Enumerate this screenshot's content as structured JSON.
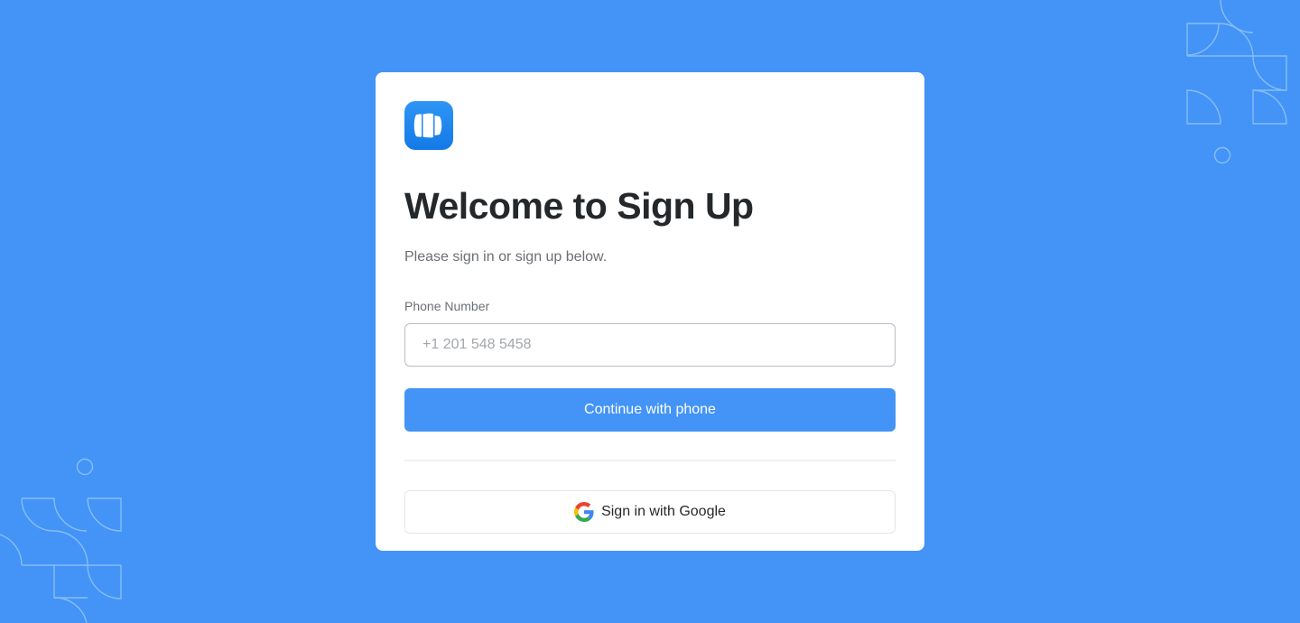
{
  "card": {
    "logo_icon": "app-logo-icon",
    "title": "Welcome to Sign Up",
    "subtitle": "Please sign in or sign up below.",
    "phone": {
      "label": "Phone Number",
      "placeholder": "+1 201 548 5458",
      "value": ""
    },
    "continue_label": "Continue with phone",
    "google_icon": "google-icon",
    "google_label": "Sign in with Google"
  },
  "colors": {
    "background": "#4394f6",
    "card": "#ffffff",
    "primary_button": "#4394f6",
    "title_text": "#25282b",
    "muted_text": "#6b6f75"
  }
}
